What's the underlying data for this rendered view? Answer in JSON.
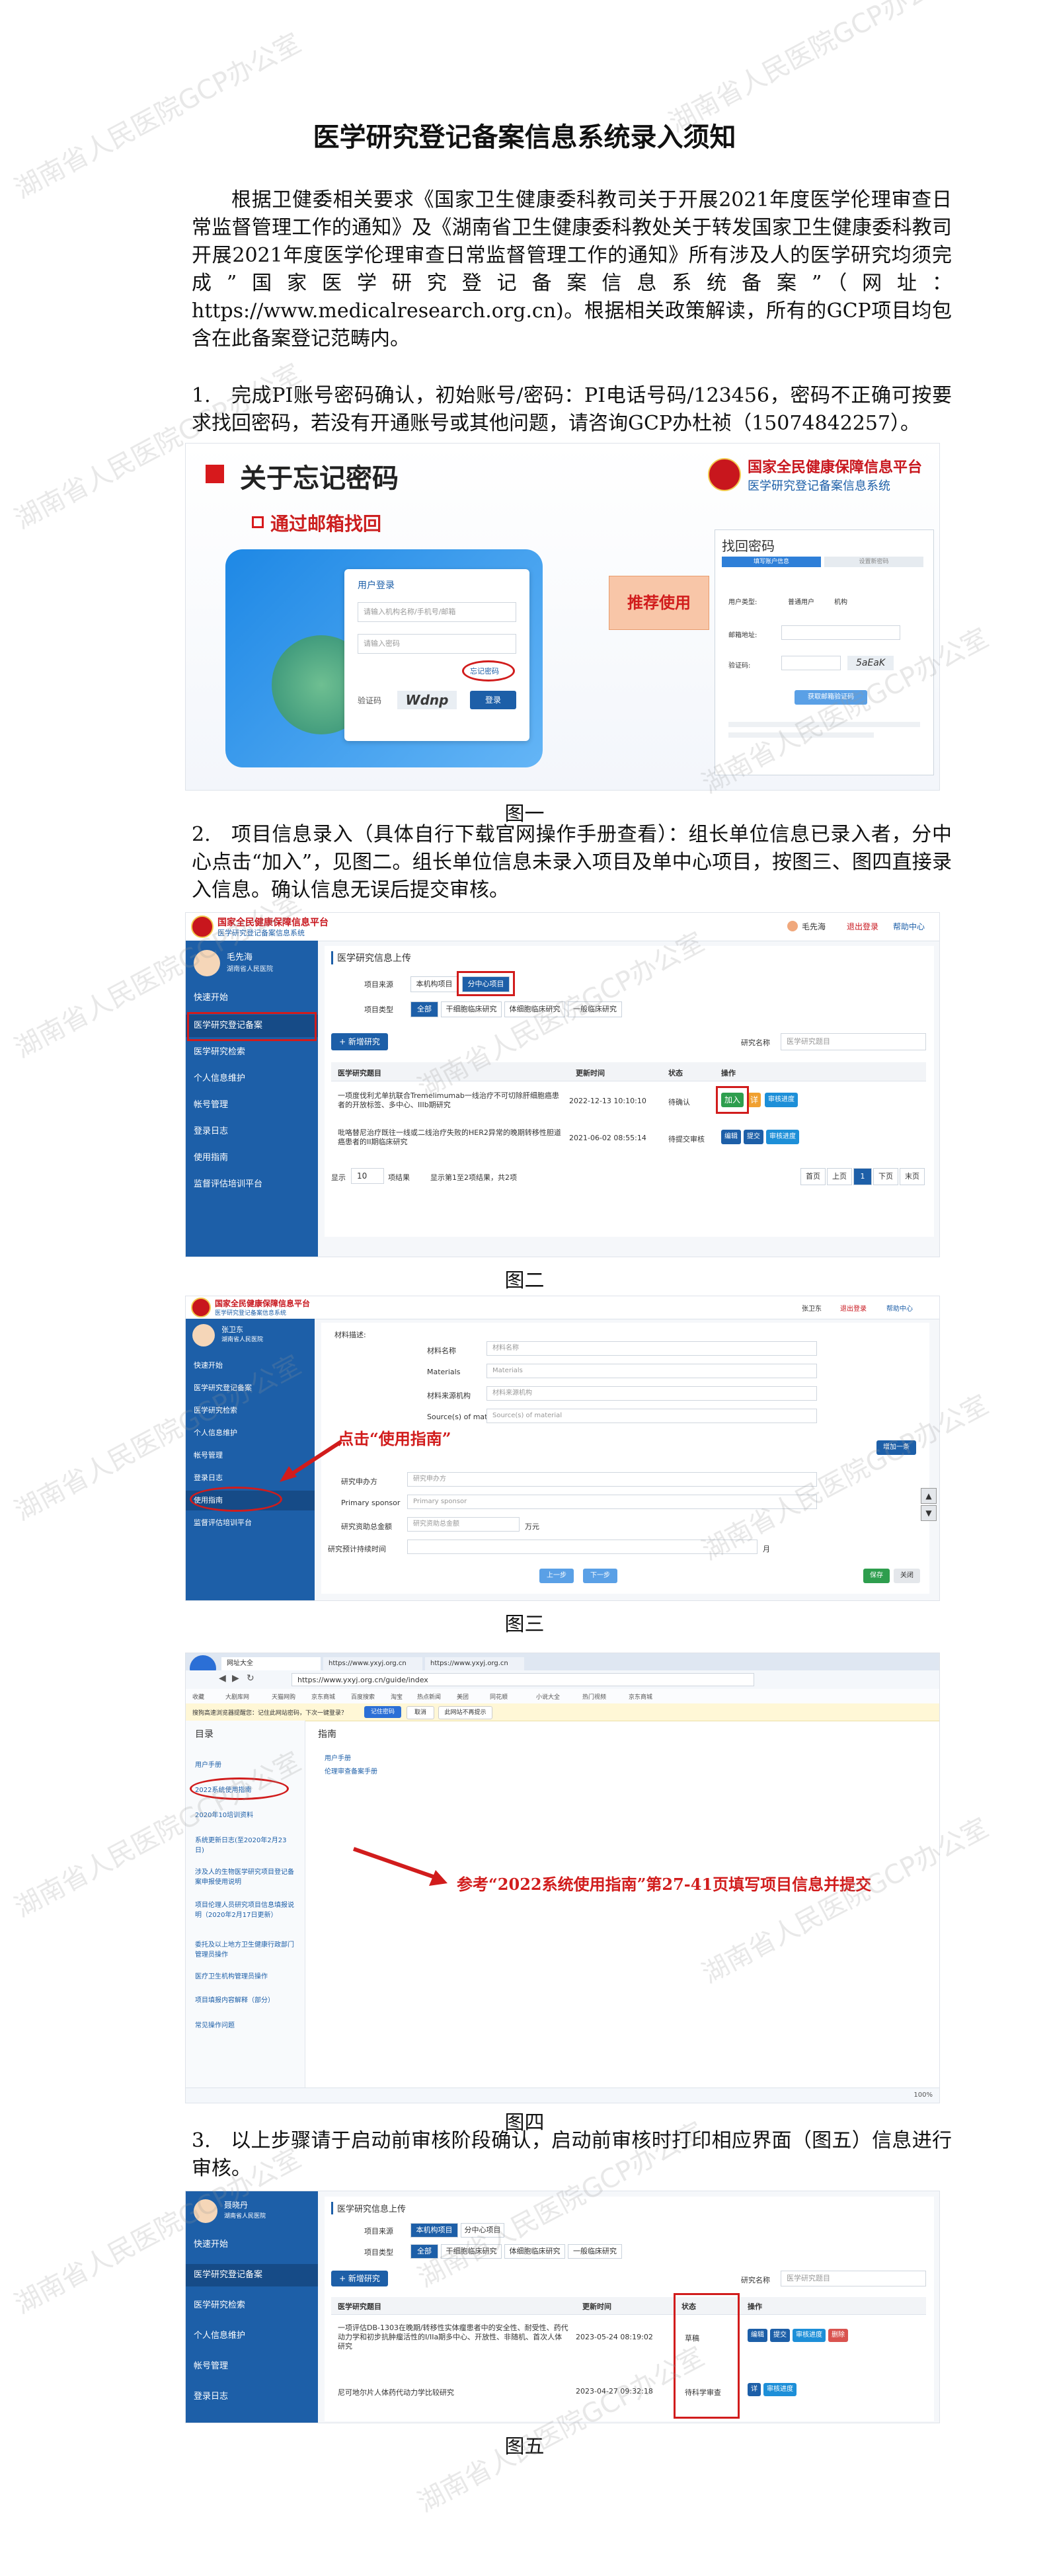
{
  "doc": {
    "title": "医学研究登记备案信息系统录入须知",
    "intro": "根据卫健委相关要求《国家卫生健康委科教司关于开展2021年度医学伦理审查日常监督管理工作的通知》及《湖南省卫生健康委科教处关于转发国家卫生健康委科教司开展2021年度医学伦理审查日常监督管理工作的通知》所有涉及人的医学研究均须完成”国家医学研究登记备案信息系统备案”（网址：https://www.medicalresearch.org.cn)。根据相关政策解读，所有的GCP项目均包含在此备案登记范畴内。",
    "step1": "1.　完成PI账号密码确认，初始账号/密码：PI电话号码/123456，密码不正确可按要求找回密码，若没有开通账号或其他问题，请咨询GCP办杜祯（15074842257）。",
    "step2": "2.　项目信息录入（具体自行下载官网操作手册查看）：组长单位信息已录入者，分中心点击“加入”，见图二。组长单位信息未录入项目及单中心项目，按图三、图四直接录入信息。确认信息无误后提交审核。",
    "step3": "3.　以上步骤请于启动前审核阶段确认，启动前审核时打印相应界面（图五）信息进行审核。",
    "captions": [
      "图一",
      "图二",
      "图三",
      "图四",
      "图五"
    ],
    "watermark": "湖南省人民医院GCP办公室"
  },
  "fig1": {
    "heading": "关于忘记密码",
    "subheading": "通过邮箱找回",
    "brand_line1": "国家全民健康保障信息平台",
    "brand_line2": "医学研究登记备案信息系统",
    "login_title": "用户登录",
    "login_user_placeholder": "请输入机构名称/手机号/邮箱",
    "login_pass_placeholder": "请输入密码",
    "captcha_label": "验证码",
    "captcha_text": "Wdnp",
    "forgot_label": "忘记密码",
    "login_button": "登录",
    "recommend": "推荐使用",
    "reset_title": "找回密码",
    "reset_steps": [
      "填写账户信息",
      "设置新密码"
    ],
    "reset_user_type": "用户类型:",
    "reset_type_options": [
      "普通用户",
      "机构"
    ],
    "reset_email_label": "邮箱地址:",
    "reset_code_label": "验证码:",
    "reset_code_text": "5aEaK",
    "reset_button": "获取邮箱验证码"
  },
  "sys": {
    "brand_line1": "国家全民健康保障信息平台",
    "brand_line2": "医学研究登记备案信息系统",
    "logout": "退出登录",
    "help": "帮助中心",
    "org": "湖南省人民医院",
    "nav": [
      "快速开始",
      "医学研究登记备案",
      "医学研究检索",
      "个人信息维护",
      "帐号管理",
      "登录日志",
      "使用指南",
      "监督评估培训平台"
    ]
  },
  "fig2": {
    "user": "毛先海",
    "page_title": "医学研究信息上传",
    "source_label": "项目来源",
    "source_tabs": [
      "本机构项目",
      "分中心项目"
    ],
    "type_label": "项目类型",
    "type_tabs": [
      "全部",
      "干细胞临床研究",
      "体细胞临床研究",
      "一般临床研究"
    ],
    "add_button": "+ 新增研究",
    "search_label": "研究名称",
    "search_placeholder": "医学研究题目",
    "columns": [
      "医学研究题目",
      "更新时间",
      "状态",
      "操作"
    ],
    "rows": [
      {
        "title": "一项度伐利尤单抗联合Tremelimumab一线治疗不可切除肝细胞癌患者的开放标签、多中心、IIIb期研究",
        "time": "2022-12-13 10:10:10",
        "status": "待确认",
        "ops": [
          "加入",
          "详",
          "审核进度"
        ]
      },
      {
        "title": "吡咯替尼治疗既往一线或二线治疗失败的HER2异常的晚期转移性胆道癌患者的II期临床研究",
        "time": "2021-06-02 08:55:14",
        "status": "待提交审核",
        "ops": [
          "编辑",
          "提交",
          "审核进度"
        ]
      }
    ],
    "page_size": "10",
    "page_size_suffix": "项结果",
    "page_info": "显示第1至2项结果，共2项",
    "pager": [
      "首页",
      "上页",
      "1",
      "下页",
      "末页"
    ]
  },
  "fig3": {
    "user": "张卫东",
    "section_label": "材料描述:",
    "fields": [
      "材料名称",
      "Materials",
      "材料来源机构",
      "Source(s) of material"
    ],
    "placeholders": [
      "材料名称",
      "Materials",
      "材料来源机构",
      "Source(s) of material"
    ],
    "add_one": "增加一条",
    "sponsor_label": "研究申办方",
    "sponsor_placeholder": "研究申办方",
    "sponsor_en_label": "Primary sponsor",
    "sponsor_en_placeholder": "Primary sponsor",
    "amount_label": "研究资助总金额",
    "amount_placeholder": "研究资助总金额",
    "amount_unit": "万元",
    "period_label": "研究预计持续时间",
    "period_unit": "月",
    "prev_button": "上一步",
    "next_button": "下一步",
    "save_button": "保存",
    "close_button": "关闭",
    "annotation": "点击“使用指南”"
  },
  "fig4": {
    "tabs": [
      "网址大全",
      "https://www.yxyj.org.cn",
      "https://www.yxyj.org.cn"
    ],
    "url": "https://www.yxyj.org.cn/guide/index",
    "bookmarks": [
      "收藏",
      "大剧库网",
      "天猫网购",
      "京东商城",
      "百度搜索",
      "淘宝",
      "热点新闻",
      "美团",
      "同花顺",
      "小说大全",
      "热门视频",
      "京东商城"
    ],
    "notice": "搜狗高速浏览器提醒您：记住此网站密码，下次一键登录？",
    "notice_buttons": [
      "记住密码",
      "取消",
      "此网站不再提示"
    ],
    "toc_title": "目录",
    "toc_items": [
      "用户手册",
      "2022系统使用指南",
      "2020年10培训资料",
      "系统更新日志(至2020年2月23日)",
      "涉及人的生物医学研究项目登记备案申报使用说明",
      "项目伦理人员研究项目信息填报说明（2020年2月17日更新）",
      "委托及以上地方卫生健康行政部门管理员操作",
      "医疗卫生机构管理员操作",
      "项目填报内容解释（部分）",
      "常见操作问题"
    ],
    "guide_title": "指南",
    "guide_links": [
      "用户手册",
      "伦理审查备案手册"
    ],
    "annotation": "参考“2022系统使用指南”第27-41页填写项目信息并提交",
    "status_right": "100%"
  },
  "fig5": {
    "user": "聂晓丹",
    "page_title": "医学研究信息上传",
    "source_label": "项目来源",
    "source_tabs": [
      "本机构项目",
      "分中心项目"
    ],
    "type_label": "项目类型",
    "type_tabs": [
      "全部",
      "干细胞临床研究",
      "体细胞临床研究",
      "一般临床研究"
    ],
    "add_button": "+ 新增研究",
    "search_label": "研究名称",
    "search_placeholder": "医学研究题目",
    "columns": [
      "医学研究题目",
      "更新时间",
      "状态",
      "操作"
    ],
    "rows": [
      {
        "title": "一项评估DB-1303在晚期/转移性实体瘤患者中的安全性、耐受性、药代动力学和初步抗肿瘤活性的I/IIa期多中心、开放性、非随机、首次人体研究",
        "time": "2023-05-24 08:19:02",
        "status": "草稿",
        "ops": [
          "编辑",
          "提交",
          "审核进度",
          "删除"
        ]
      },
      {
        "title": "尼可地尔片人体药代动力学比较研究",
        "time": "2023-04-27 09:32:18",
        "status": "待科学审查",
        "ops": [
          "详",
          "审核进度"
        ]
      }
    ]
  }
}
